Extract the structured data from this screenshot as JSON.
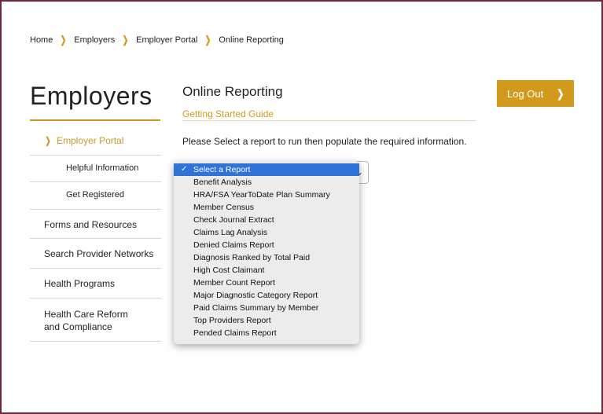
{
  "breadcrumb": [
    "Home",
    "Employers",
    "Employer Portal",
    "Online Reporting"
  ],
  "sidebar": {
    "title": "Employers",
    "items": [
      {
        "label": "Employer Portal",
        "active": true
      },
      {
        "label": "Helpful Information",
        "sub": true
      },
      {
        "label": "Get Registered",
        "sub": true
      },
      {
        "label": "Forms and Resources"
      },
      {
        "label": "Search Provider Networks"
      },
      {
        "label": "Health Programs"
      },
      {
        "label": "Health Care Reform and Compliance"
      }
    ]
  },
  "main": {
    "title": "Online Reporting",
    "guide_link": "Getting Started Guide",
    "instruction": "Please Select a report to run then populate the required information.",
    "logout_label": "Log Out"
  },
  "report_select": {
    "selected": "Select a Report",
    "options": [
      "Select a Report",
      "Benefit Analysis",
      "HRA/FSA YearToDate Plan Summary",
      "Member Census",
      "Check Journal Extract",
      "Claims Lag Analysis",
      "Denied Claims Report",
      "Diagnosis Ranked by Total Paid",
      "High Cost Claimant",
      "Member Count Report",
      "Major Diagnostic Category Report",
      "Paid Claims Summary by Member",
      "Top Providers Report",
      "Pended Claims Report"
    ]
  },
  "colors": {
    "accent": "#d19a1c",
    "frame": "#6b2a3a",
    "selection": "#2f73d9"
  },
  "icons": {
    "breadcrumb_separator": "chevron-right-icon",
    "logout_arrow": "chevron-right-icon",
    "select_caret": "chevron-down-icon",
    "selected_check": "checkmark-icon"
  }
}
